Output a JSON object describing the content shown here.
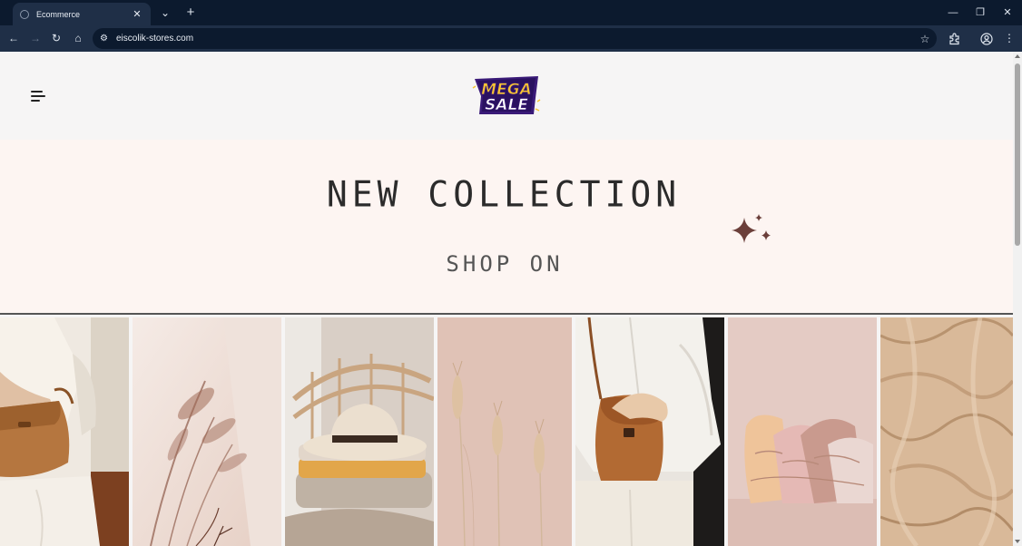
{
  "browser": {
    "tab_title": "Ecommerce",
    "url": "eiscolik-stores.com",
    "icons": {
      "tab_close": "close-icon",
      "tab_list": "chevron-down-icon",
      "new_tab": "plus-icon",
      "minimize": "minimize-icon",
      "restore": "restore-icon",
      "close_window": "close-icon",
      "back": "arrow-left-icon",
      "forward": "arrow-right-icon",
      "reload": "reload-icon",
      "home": "home-icon",
      "site_info": "tune-icon",
      "bookmark": "star-icon",
      "extensions": "puzzle-icon",
      "profile": "profile-icon",
      "menu": "kebab-icon"
    }
  },
  "header": {
    "menu_icon": "hamburger-icon",
    "logo": {
      "line1": "MEGA",
      "line2": "SALE"
    }
  },
  "hero": {
    "title": "NEW COLLECTION",
    "subtitle": "SHOP ON",
    "decoration": "sparkle-icon"
  },
  "colors": {
    "chrome_dark": "#0c1a2e",
    "chrome_toolbar": "#1f2f47",
    "hero_bg": "#fdf5f2",
    "header_bg": "#f6f5f5",
    "sparkle": "#6b3f3a",
    "logo_fill": "#f8c531",
    "logo_outline": "#3a1a78"
  },
  "gallery": {
    "tiles": [
      {
        "subject": "leather crossbody bag on white linen outfit"
      },
      {
        "subject": "dried grass shadow on beige wall"
      },
      {
        "subject": "straw hat on folded sweaters on rattan chair"
      },
      {
        "subject": "dried wheat stems on pink background"
      },
      {
        "subject": "person holding tan leather bag"
      },
      {
        "subject": "stack of folded pastel clothes"
      },
      {
        "subject": "wrinkled beige linen fabric"
      }
    ]
  }
}
